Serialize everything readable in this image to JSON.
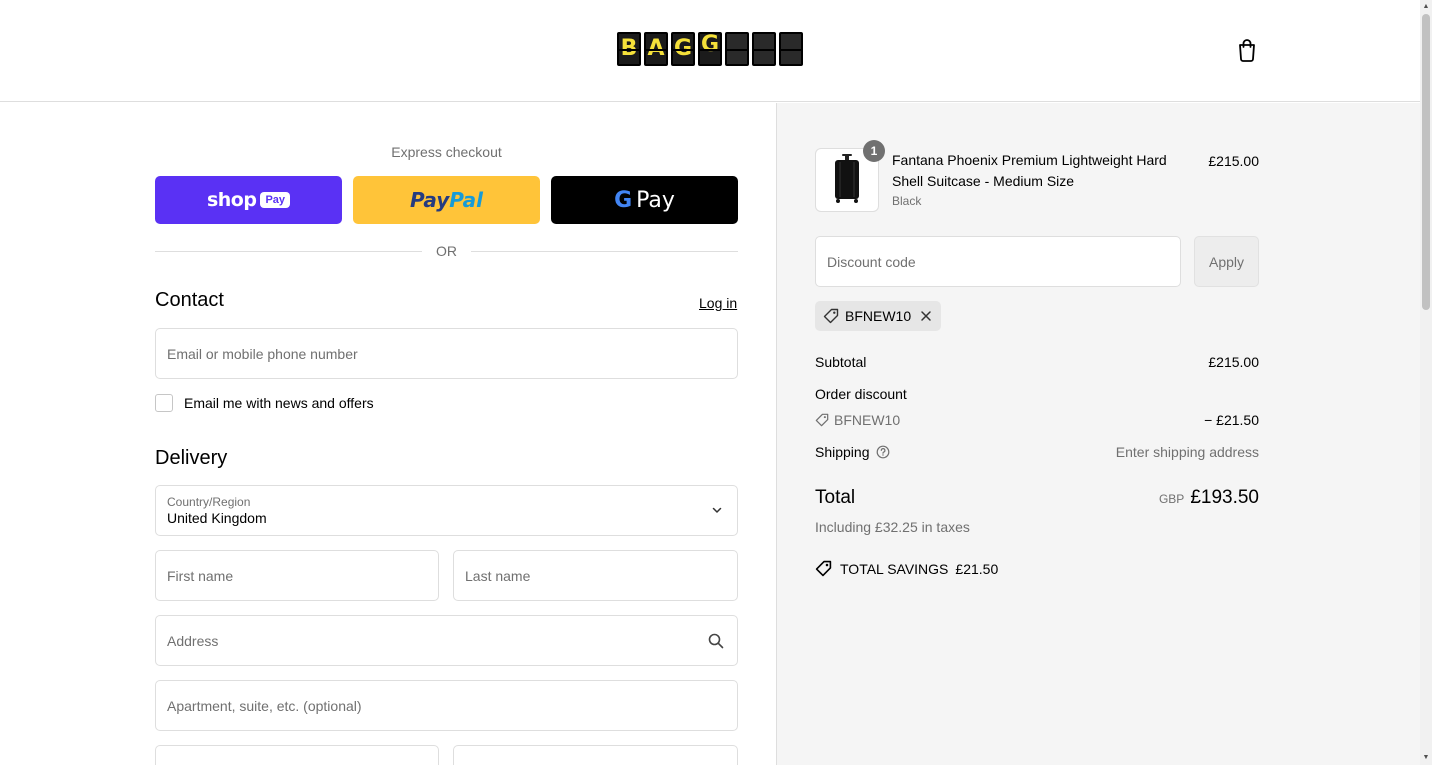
{
  "header": {
    "logo_letters": [
      "B",
      "A",
      "G",
      "G",
      "",
      "",
      ""
    ]
  },
  "express": {
    "title": "Express checkout",
    "shop_label": "shop",
    "shop_pill": "Pay",
    "paypal_pay": "Pay",
    "paypal_pal": "Pal",
    "gpay_g": "G",
    "gpay_label": "Pay",
    "or": "OR"
  },
  "contact": {
    "title": "Contact",
    "login": "Log in",
    "email_placeholder": "Email or mobile phone number",
    "newsletter": "Email me with news and offers"
  },
  "delivery": {
    "title": "Delivery",
    "country_label": "Country/Region",
    "country_value": "United Kingdom",
    "first_name": "First name",
    "last_name": "Last name",
    "address": "Address",
    "apartment": "Apartment, suite, etc. (optional)"
  },
  "summary": {
    "quantity": "1",
    "product_name": "Fantana Phoenix Premium Lightweight Hard Shell Suitcase - Medium Size",
    "variant": "Black",
    "price": "£215.00",
    "discount_placeholder": "Discount code",
    "apply": "Apply",
    "applied_code": "BFNEW10",
    "subtotal_label": "Subtotal",
    "subtotal_value": "£215.00",
    "order_discount_label": "Order discount",
    "discount_code": "BFNEW10",
    "discount_value": "− £21.50",
    "shipping_label": "Shipping",
    "shipping_value": "Enter shipping address",
    "total_label": "Total",
    "currency": "GBP",
    "total_value": "£193.50",
    "taxes": "Including £32.25 in taxes",
    "savings_label": "TOTAL SAVINGS",
    "savings_value": "£21.50"
  },
  "colors": {
    "shop_pay": "#5a31f4",
    "paypal": "#ffc439",
    "gpay": "#000000",
    "summary_bg": "#f5f5f5"
  }
}
